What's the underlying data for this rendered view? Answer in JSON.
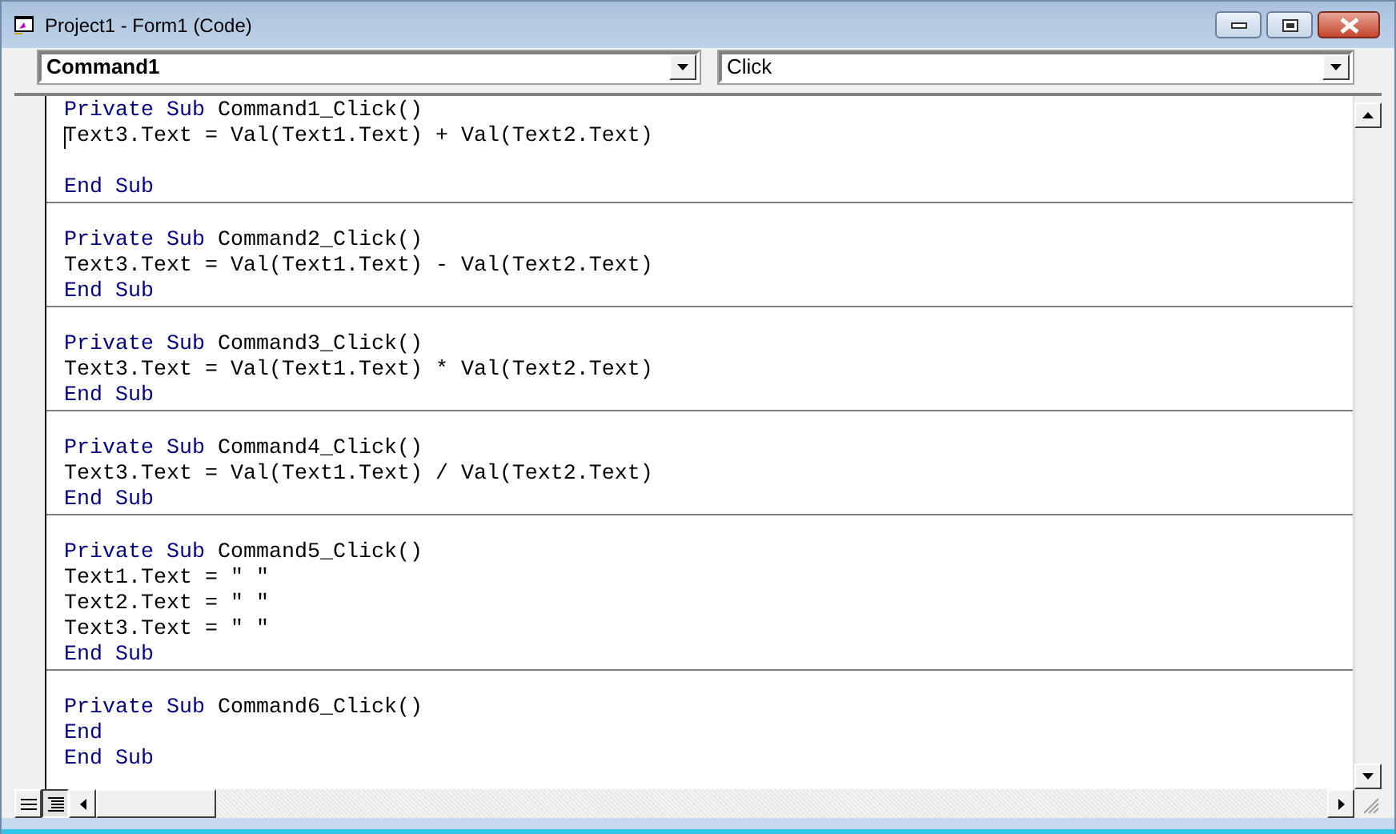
{
  "window": {
    "title": "Project1 - Form1 (Code)"
  },
  "object_combo": {
    "value": "Command1",
    "bold": true
  },
  "procedure_combo": {
    "value": "Click",
    "bold": false
  },
  "procedures": [
    {
      "lines": [
        {
          "kind": "code",
          "tokens": [
            {
              "text": "Private Sub ",
              "kind": "keyword"
            },
            {
              "text": "Command1_Click()",
              "kind": "plain"
            }
          ]
        },
        {
          "kind": "code",
          "caret": true,
          "tokens": [
            {
              "text": "Text3.Text = Val(Text1.Text) + Val(Text2.Text)",
              "kind": "plain"
            }
          ]
        },
        {
          "kind": "blank"
        },
        {
          "kind": "code",
          "tokens": [
            {
              "text": "End Sub",
              "kind": "keyword"
            }
          ]
        }
      ]
    },
    {
      "lines": [
        {
          "kind": "code",
          "tokens": [
            {
              "text": "Private Sub ",
              "kind": "keyword"
            },
            {
              "text": "Command2_Click()",
              "kind": "plain"
            }
          ]
        },
        {
          "kind": "code",
          "tokens": [
            {
              "text": "Text3.Text = Val(Text1.Text) - Val(Text2.Text)",
              "kind": "plain"
            }
          ]
        },
        {
          "kind": "code",
          "tokens": [
            {
              "text": "End Sub",
              "kind": "keyword"
            }
          ]
        }
      ]
    },
    {
      "lines": [
        {
          "kind": "code",
          "tokens": [
            {
              "text": "Private Sub ",
              "kind": "keyword"
            },
            {
              "text": "Command3_Click()",
              "kind": "plain"
            }
          ]
        },
        {
          "kind": "code",
          "tokens": [
            {
              "text": "Text3.Text = Val(Text1.Text) * Val(Text2.Text)",
              "kind": "plain"
            }
          ]
        },
        {
          "kind": "code",
          "tokens": [
            {
              "text": "End Sub",
              "kind": "keyword"
            }
          ]
        }
      ]
    },
    {
      "lines": [
        {
          "kind": "code",
          "tokens": [
            {
              "text": "Private Sub ",
              "kind": "keyword"
            },
            {
              "text": "Command4_Click()",
              "kind": "plain"
            }
          ]
        },
        {
          "kind": "code",
          "tokens": [
            {
              "text": "Text3.Text = Val(Text1.Text) / Val(Text2.Text)",
              "kind": "plain"
            }
          ]
        },
        {
          "kind": "code",
          "tokens": [
            {
              "text": "End Sub",
              "kind": "keyword"
            }
          ]
        }
      ]
    },
    {
      "lines": [
        {
          "kind": "code",
          "tokens": [
            {
              "text": "Private Sub ",
              "kind": "keyword"
            },
            {
              "text": "Command5_Click()",
              "kind": "plain"
            }
          ]
        },
        {
          "kind": "code",
          "tokens": [
            {
              "text": "Text1.Text = \" \"",
              "kind": "plain"
            }
          ]
        },
        {
          "kind": "code",
          "tokens": [
            {
              "text": "Text2.Text = \" \"",
              "kind": "plain"
            }
          ]
        },
        {
          "kind": "code",
          "tokens": [
            {
              "text": "Text3.Text = \" \"",
              "kind": "plain"
            }
          ]
        },
        {
          "kind": "code",
          "tokens": [
            {
              "text": "End Sub",
              "kind": "keyword"
            }
          ]
        }
      ]
    },
    {
      "lines": [
        {
          "kind": "code",
          "tokens": [
            {
              "text": "Private Sub ",
              "kind": "keyword"
            },
            {
              "text": "Command6_Click()",
              "kind": "plain"
            }
          ]
        },
        {
          "kind": "code",
          "tokens": [
            {
              "text": "End",
              "kind": "keyword"
            }
          ]
        },
        {
          "kind": "code",
          "tokens": [
            {
              "text": "End Sub",
              "kind": "keyword"
            }
          ]
        }
      ]
    }
  ],
  "view_buttons": [
    {
      "kind": "procedure",
      "selected": false
    },
    {
      "kind": "module",
      "selected": true
    }
  ]
}
